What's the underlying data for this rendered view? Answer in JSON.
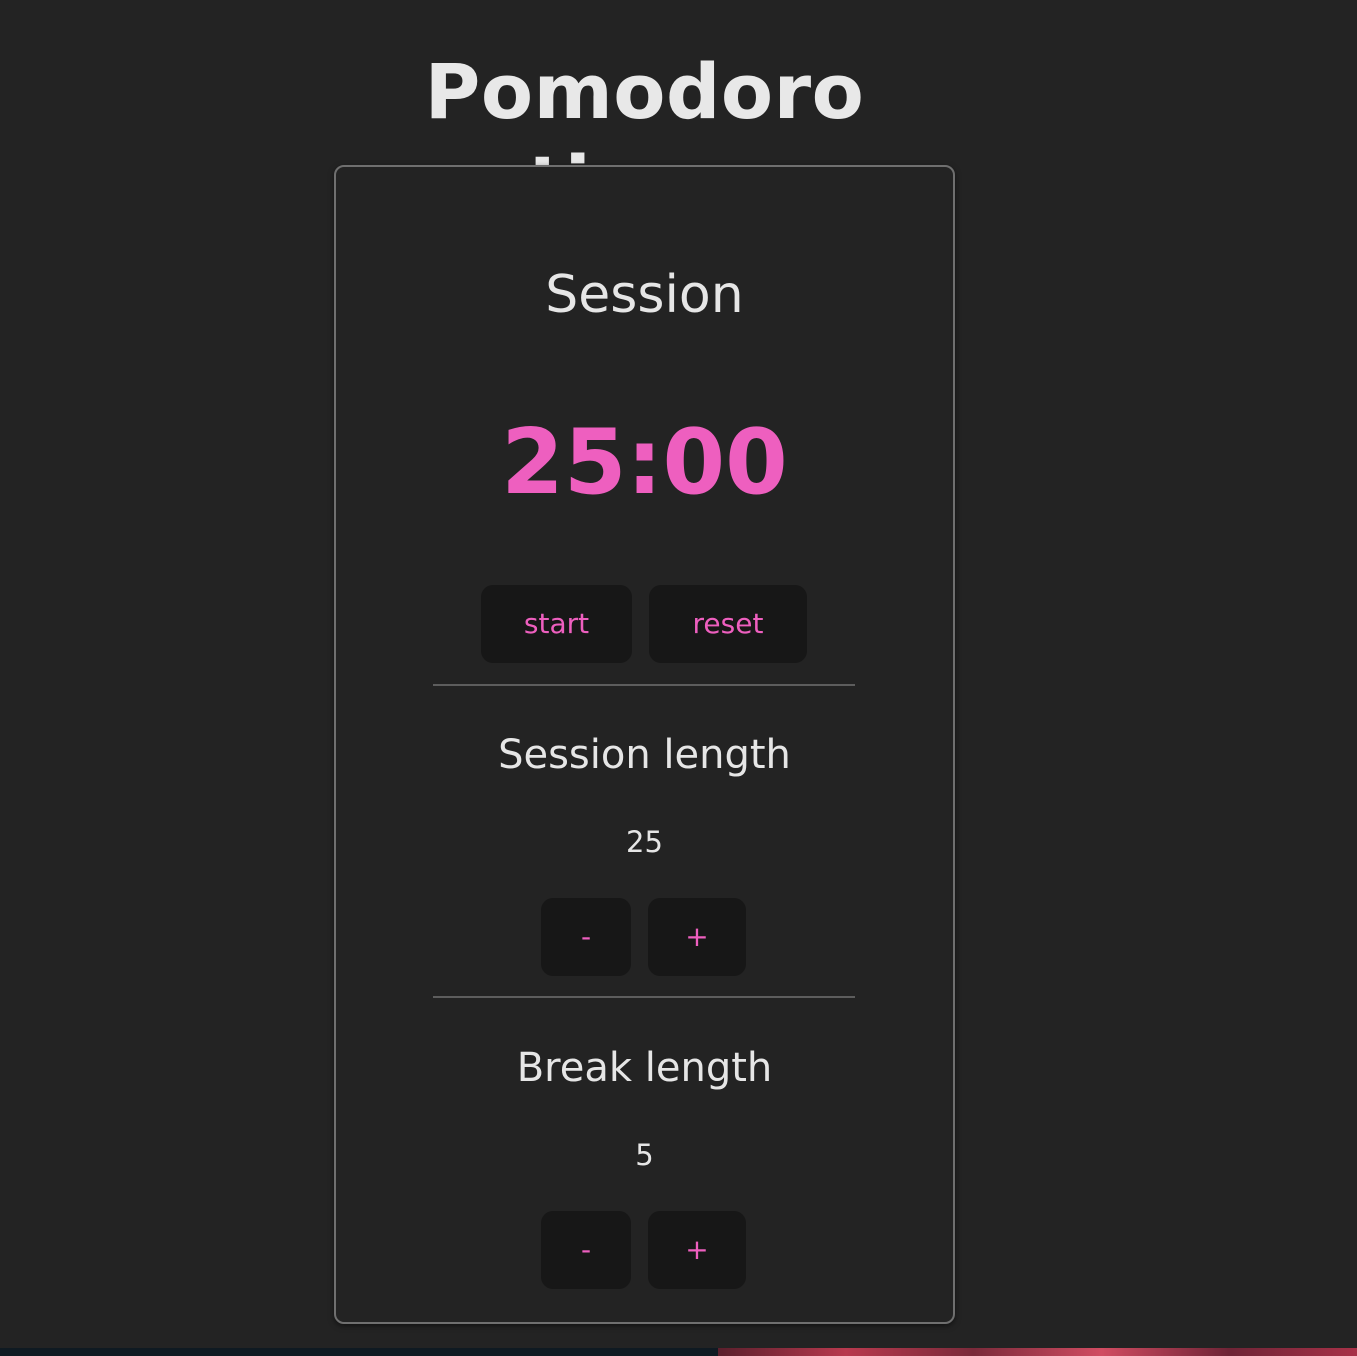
{
  "app": {
    "title": "Pomodoro timer"
  },
  "timer": {
    "mode_label": "Session",
    "display": "25:00",
    "start_label": "start",
    "reset_label": "reset"
  },
  "session_length": {
    "title": "Session length",
    "value": "25",
    "decrement_label": "-",
    "increment_label": "+"
  },
  "break_length": {
    "title": "Break length",
    "value": "5",
    "decrement_label": "-",
    "increment_label": "+"
  },
  "colors": {
    "background": "#232323",
    "accent": "#ee5fbf",
    "button_bg": "#171717",
    "text": "#e6e6e6",
    "border": "#6f6f6f"
  }
}
